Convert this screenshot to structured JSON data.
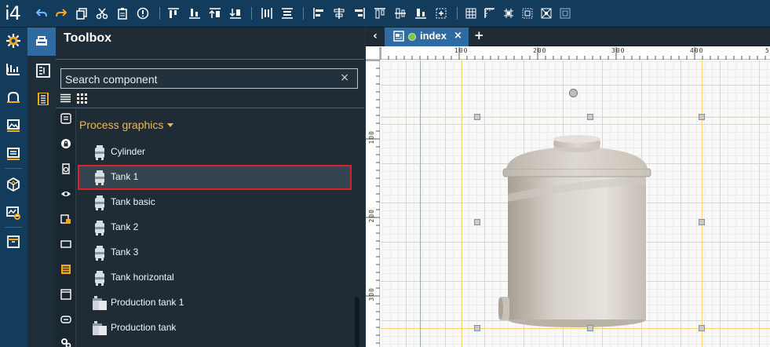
{
  "app": {
    "logo": "i4"
  },
  "toolbox": {
    "title": "Toolbox",
    "search_placeholder": "Search component",
    "search_value": "",
    "clear_symbol": "×",
    "group": {
      "label": "Process graphics"
    },
    "items": [
      {
        "label": "Cylinder",
        "icon": "tank-component-icon",
        "selected": false
      },
      {
        "label": "Tank 1",
        "icon": "tank-component-icon",
        "selected": true
      },
      {
        "label": "Tank basic",
        "icon": "tank-component-icon",
        "selected": false
      },
      {
        "label": "Tank 2",
        "icon": "tank-component-icon",
        "selected": false
      },
      {
        "label": "Tank 3",
        "icon": "tank-component-icon",
        "selected": false
      },
      {
        "label": "Tank horizontal",
        "icon": "tank-component-icon",
        "selected": false
      },
      {
        "label": "Production tank 1",
        "icon": "production-tank-icon",
        "selected": false
      },
      {
        "label": "Production tank",
        "icon": "production-tank-icon",
        "selected": false
      }
    ]
  },
  "editor": {
    "tab": {
      "label": "index",
      "close": "×"
    },
    "back_symbol": "‹",
    "add_symbol": "+",
    "ruler": {
      "top": [
        "100",
        "200",
        "300",
        "400",
        "5"
      ],
      "left": [
        "100",
        "200",
        "300"
      ]
    }
  },
  "colors": {
    "accent": "#2f6aa0",
    "toolbar_bg": "#133b5c",
    "group_header": "#f4b84b",
    "selection_border": "#d8212a",
    "guide": "#ffd766",
    "cyan_guide": "#4fc3f7",
    "tab_status": "#7fc241"
  }
}
